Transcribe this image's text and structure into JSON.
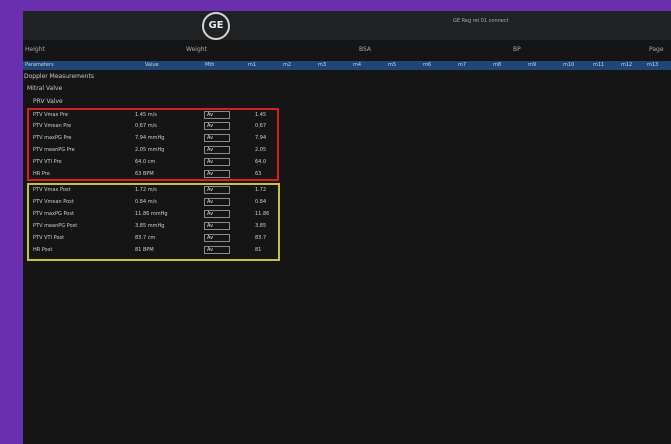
{
  "header": {
    "logo_text": "GE",
    "device_status": "GE Reg rel 01 connect"
  },
  "patient_info": {
    "height_label": "Height",
    "weight_label": "Weight",
    "bsa_label": "BSA",
    "bp_label": "BP",
    "page_label": "Page"
  },
  "columns": [
    "Parameters",
    "Value",
    "Mth",
    "m1",
    "m2",
    "m3",
    "m4",
    "m5",
    "m6",
    "m7",
    "m8",
    "m9",
    "m10",
    "m11",
    "m12",
    "m13"
  ],
  "tree": {
    "section": "Doppler Measurements",
    "subsection": "Mitral Valve",
    "group": "PRV Valve"
  },
  "pre_rows": [
    {
      "param": "PTV Vmax Pre",
      "value": "1.45 m/s",
      "method": "Av",
      "m1": "1.45"
    },
    {
      "param": "PTV Vmean Pre",
      "value": "0.67 m/s",
      "method": "Av",
      "m1": "0.67"
    },
    {
      "param": "PTV maxPG Pre",
      "value": "7.94 mmHg",
      "method": "Av",
      "m1": "7.94"
    },
    {
      "param": "PTV meanPG Pre",
      "value": "2.05 mmHg",
      "method": "Av",
      "m1": "2.05"
    },
    {
      "param": "PTV VTI Pre",
      "value": "64.0 cm",
      "method": "Av",
      "m1": "64.0"
    },
    {
      "param": "HR Pre",
      "value": "63 BPM",
      "method": "Av",
      "m1": "63"
    }
  ],
  "post_rows": [
    {
      "param": "PTV Vmax Post",
      "value": "1.72 m/s",
      "method": "Av",
      "m1": "1.72"
    },
    {
      "param": "PTV Vmean Post",
      "value": "0.84 m/s",
      "method": "Av",
      "m1": "0.84"
    },
    {
      "param": "PTV maxPG Post",
      "value": "11.86 mmHg",
      "method": "Av",
      "m1": "11.86"
    },
    {
      "param": "PTV meanPG Post",
      "value": "3.85 mmHg",
      "method": "Av",
      "m1": "3.85"
    },
    {
      "param": "PTV VTI Post",
      "value": "83.7 cm",
      "method": "Av",
      "m1": "83.7"
    },
    {
      "param": "HR Post",
      "value": "81 BPM",
      "method": "Av",
      "m1": "81"
    }
  ],
  "colors": {
    "pre_box": "#d92020",
    "post_box": "#c8c23a",
    "header_bar": "#1f4677"
  }
}
